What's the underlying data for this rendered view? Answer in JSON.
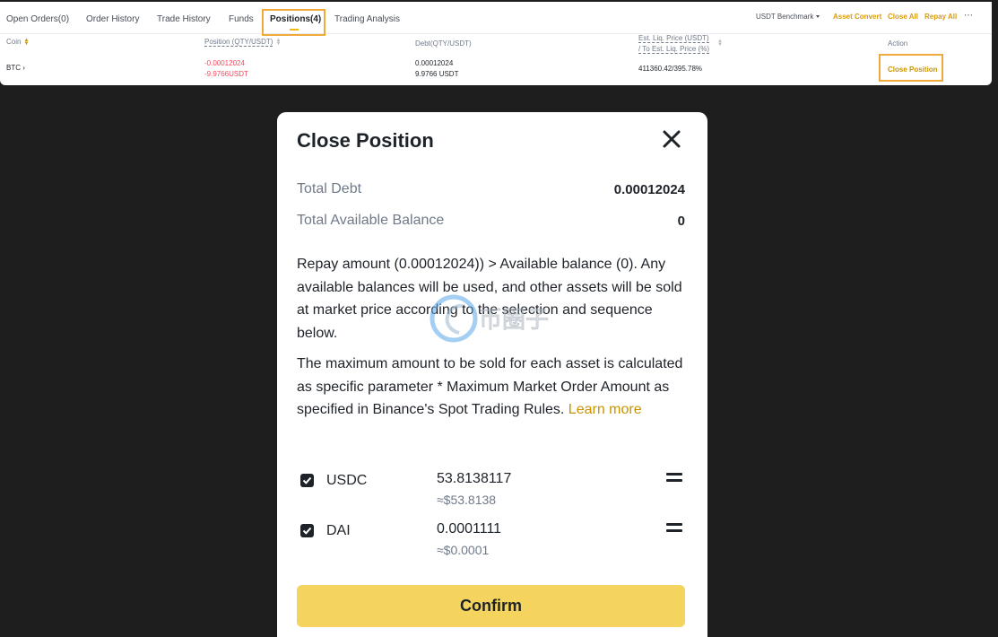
{
  "tabs": [
    {
      "label": "Open Orders(0)"
    },
    {
      "label": "Order History"
    },
    {
      "label": "Trade History"
    },
    {
      "label": "Funds"
    },
    {
      "label": "Positions(4)"
    },
    {
      "label": "Trading Analysis"
    }
  ],
  "toolbar": {
    "benchmark": "USDT Benchmark",
    "asset_convert": "Asset Convert",
    "close_all": "Close All",
    "repay_all": "Repay All",
    "more": "⋯"
  },
  "table": {
    "headers": {
      "coin": "Coin",
      "position": "Position (QTY/USDT)",
      "debt": "Debt(QTY/USDT)",
      "liq_line1": "Est. Liq. Price (USDT)",
      "liq_line2": "/ To Est. Liq. Price (%)",
      "action": "Action"
    },
    "row": {
      "coin": "BTC",
      "position_qty": "-0.00012024",
      "position_usdt": "-9.9766USDT",
      "debt_qty": "0.00012024",
      "debt_usdt": "9.9766 USDT",
      "liq": "411360.42/395.78%",
      "action": "Close Position"
    }
  },
  "modal": {
    "title": "Close Position",
    "total_debt_label": "Total Debt",
    "total_debt_value": "0.00012024",
    "available_label": "Total Available Balance",
    "available_value": "0",
    "para1": "Repay amount (0.00012024)) > Available balance (0). Any available balances will be used, and other assets will be sold at market price according to the selection and sequence below.",
    "para2": "The maximum amount to be sold for each asset is calculated as specific parameter * Maximum Market Order Amount as specified in Binance's Spot Trading Rules.",
    "learn_more": "Learn more",
    "assets": [
      {
        "name": "USDC",
        "amount": "53.8138117",
        "usd": "≈$53.8138",
        "checked": true
      },
      {
        "name": "DAI",
        "amount": "0.0001111",
        "usd": "≈$0.0001",
        "checked": true
      }
    ],
    "confirm": "Confirm"
  },
  "watermark": {
    "text": "币圈子"
  },
  "colors": {
    "accent": "#f0b90b",
    "highlight_box": "#f0a93b",
    "link_gold": "#c99400",
    "negative": "#f6465d",
    "confirm_bg": "#f4d35e",
    "backdrop": "#1e1e1e"
  }
}
